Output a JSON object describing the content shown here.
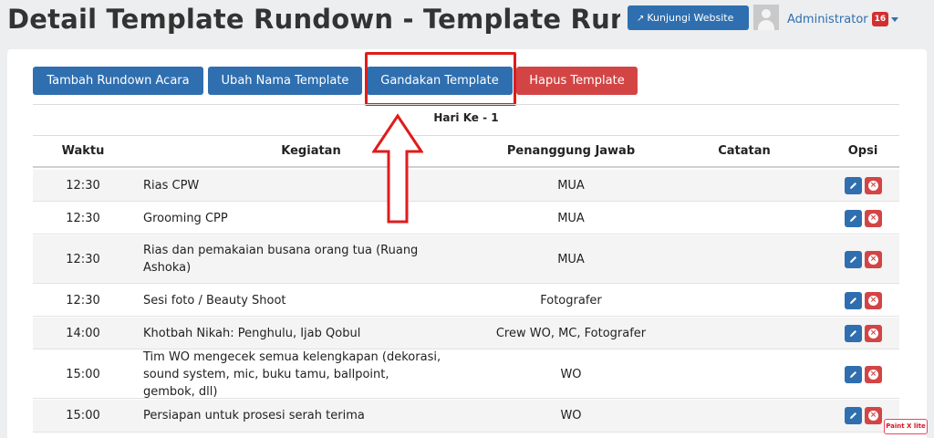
{
  "header": {
    "title": "Detail Template Rundown - Template Rundowr",
    "visit_button": "Kunjungi Website",
    "user_name": "Administrator",
    "user_badge": "16"
  },
  "actions": {
    "add": "Tambah Rundown Acara",
    "rename": "Ubah Nama Template",
    "duplicate": "Gandakan Template",
    "delete": "Hapus Template"
  },
  "day_label": "Hari Ke - 1",
  "table": {
    "columns": {
      "waktu": "Waktu",
      "kegiatan": "Kegiatan",
      "pj": "Penanggung Jawab",
      "catatan": "Catatan",
      "opsi": "Opsi"
    },
    "rows": [
      {
        "waktu": "12:30",
        "kegiatan": "Rias CPW",
        "pj": "MUA",
        "catatan": ""
      },
      {
        "waktu": "12:30",
        "kegiatan": "Grooming CPP",
        "pj": "MUA",
        "catatan": ""
      },
      {
        "waktu": "12:30",
        "kegiatan": "Rias dan pemakaian busana orang tua (Ruang Ashoka)",
        "pj": "MUA",
        "catatan": ""
      },
      {
        "waktu": "12:30",
        "kegiatan": "Sesi foto / Beauty Shoot",
        "pj": "Fotografer",
        "catatan": ""
      },
      {
        "waktu": "14:00",
        "kegiatan": "Khotbah Nikah: Penghulu, Ijab Qobul",
        "pj": "Crew WO, MC, Fotografer",
        "catatan": ""
      },
      {
        "waktu": "15:00",
        "kegiatan": "Tim WO mengecek semua kelengkapan (dekorasi, sound system, mic, buku tamu, ballpoint, gembok, dll)",
        "pj": "WO",
        "catatan": ""
      },
      {
        "waktu": "15:00",
        "kegiatan": "Persiapan untuk prosesi serah terima",
        "pj": "WO",
        "catatan": ""
      }
    ]
  },
  "watermark": "Paint X lite",
  "colors": {
    "primary": "#2f6fb0",
    "danger": "#d34545",
    "annotation": "#e01b1b"
  }
}
